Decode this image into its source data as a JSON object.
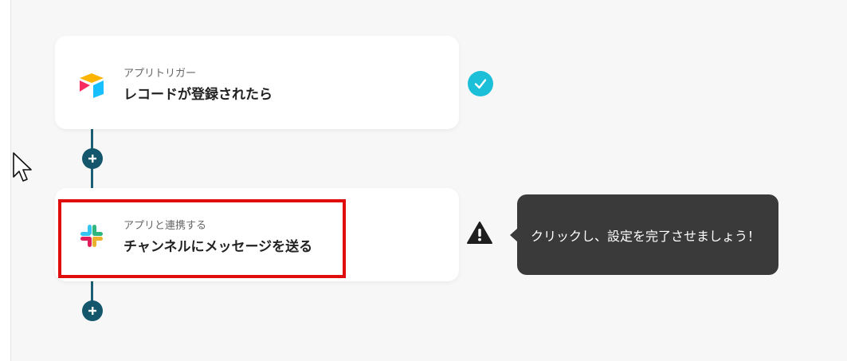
{
  "flow": {
    "trigger": {
      "category": "アプリトリガー",
      "title": "レコードが登録されたら",
      "app_icon": "airtable-icon",
      "status_icon": "check-circle-icon"
    },
    "action": {
      "category": "アプリと連携する",
      "title": "チャンネルにメッセージを送る",
      "app_icon": "slack-icon",
      "status_icon": "warning-icon"
    },
    "add_step_icon": "plus-icon"
  },
  "tooltip": {
    "text": "クリックし、設定を完了させましょう！"
  },
  "colors": {
    "background": "#f7f7f7",
    "connector": "#1a5f75",
    "check": "#1cbfd8",
    "highlight": "#e00d0d",
    "tooltip_bg": "#3a3a3a"
  }
}
